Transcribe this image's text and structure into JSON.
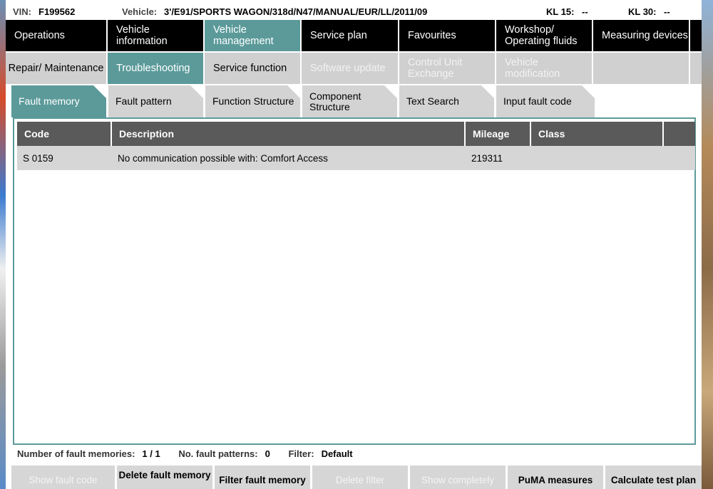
{
  "infobar": {
    "vin_label": "VIN:",
    "vin_value": "F199562",
    "vehicle_label": "Vehicle:",
    "vehicle_value": "3'/E91/SPORTS WAGON/318d/N47/MANUAL/EUR/LL/2011/09",
    "kl15_label": "KL 15:",
    "kl15_value": "--",
    "kl30_label": "KL 30:",
    "kl30_value": "--"
  },
  "main_nav": [
    {
      "label": "Operations"
    },
    {
      "label": "Vehicle information"
    },
    {
      "label": "Vehicle management",
      "active": true
    },
    {
      "label": "Service plan"
    },
    {
      "label": "Favourites"
    },
    {
      "label": "Workshop/ Operating fluids"
    },
    {
      "label": "Measuring devices"
    }
  ],
  "sub_nav": [
    {
      "label": "Repair/ Maintenance"
    },
    {
      "label": "Troubleshooting",
      "active": true
    },
    {
      "label": "Service function"
    },
    {
      "label": "Software update",
      "disabled": true
    },
    {
      "label": "Control Unit Exchange",
      "disabled": true
    },
    {
      "label": "Vehicle modification",
      "disabled": true
    }
  ],
  "folder_tabs": [
    {
      "label": "Fault memory",
      "active": true
    },
    {
      "label": "Fault pattern"
    },
    {
      "label": "Function Structure"
    },
    {
      "label": "Component Structure"
    },
    {
      "label": "Text Search"
    },
    {
      "label": "Input fault code"
    }
  ],
  "table": {
    "headers": [
      "Code",
      "Description",
      "Mileage",
      "Class"
    ],
    "rows": [
      {
        "code": "S 0159",
        "description": "No communication possible with: Comfort Access",
        "mileage": "219311",
        "class": ""
      }
    ]
  },
  "status": {
    "fault_memories_label": "Number of fault memories:",
    "fault_memories_value": "1 / 1",
    "fault_patterns_label": "No. fault patterns:",
    "fault_patterns_value": "0",
    "filter_label": "Filter:",
    "filter_value": "Default"
  },
  "buttons": [
    {
      "label": "Show fault code",
      "disabled": true
    },
    {
      "label": "Delete fault memory"
    },
    {
      "label": "Filter fault memory"
    },
    {
      "label": "Delete filter",
      "disabled": true
    },
    {
      "label": "Show completely",
      "disabled": true
    },
    {
      "label": "PuMA measures"
    },
    {
      "label": "Calculate test plan"
    }
  ],
  "colors": {
    "accent": "#5c9a9a",
    "nav_bg": "#000000",
    "table_header": "#5a5a5a",
    "row_bg": "#d6d6d6"
  }
}
